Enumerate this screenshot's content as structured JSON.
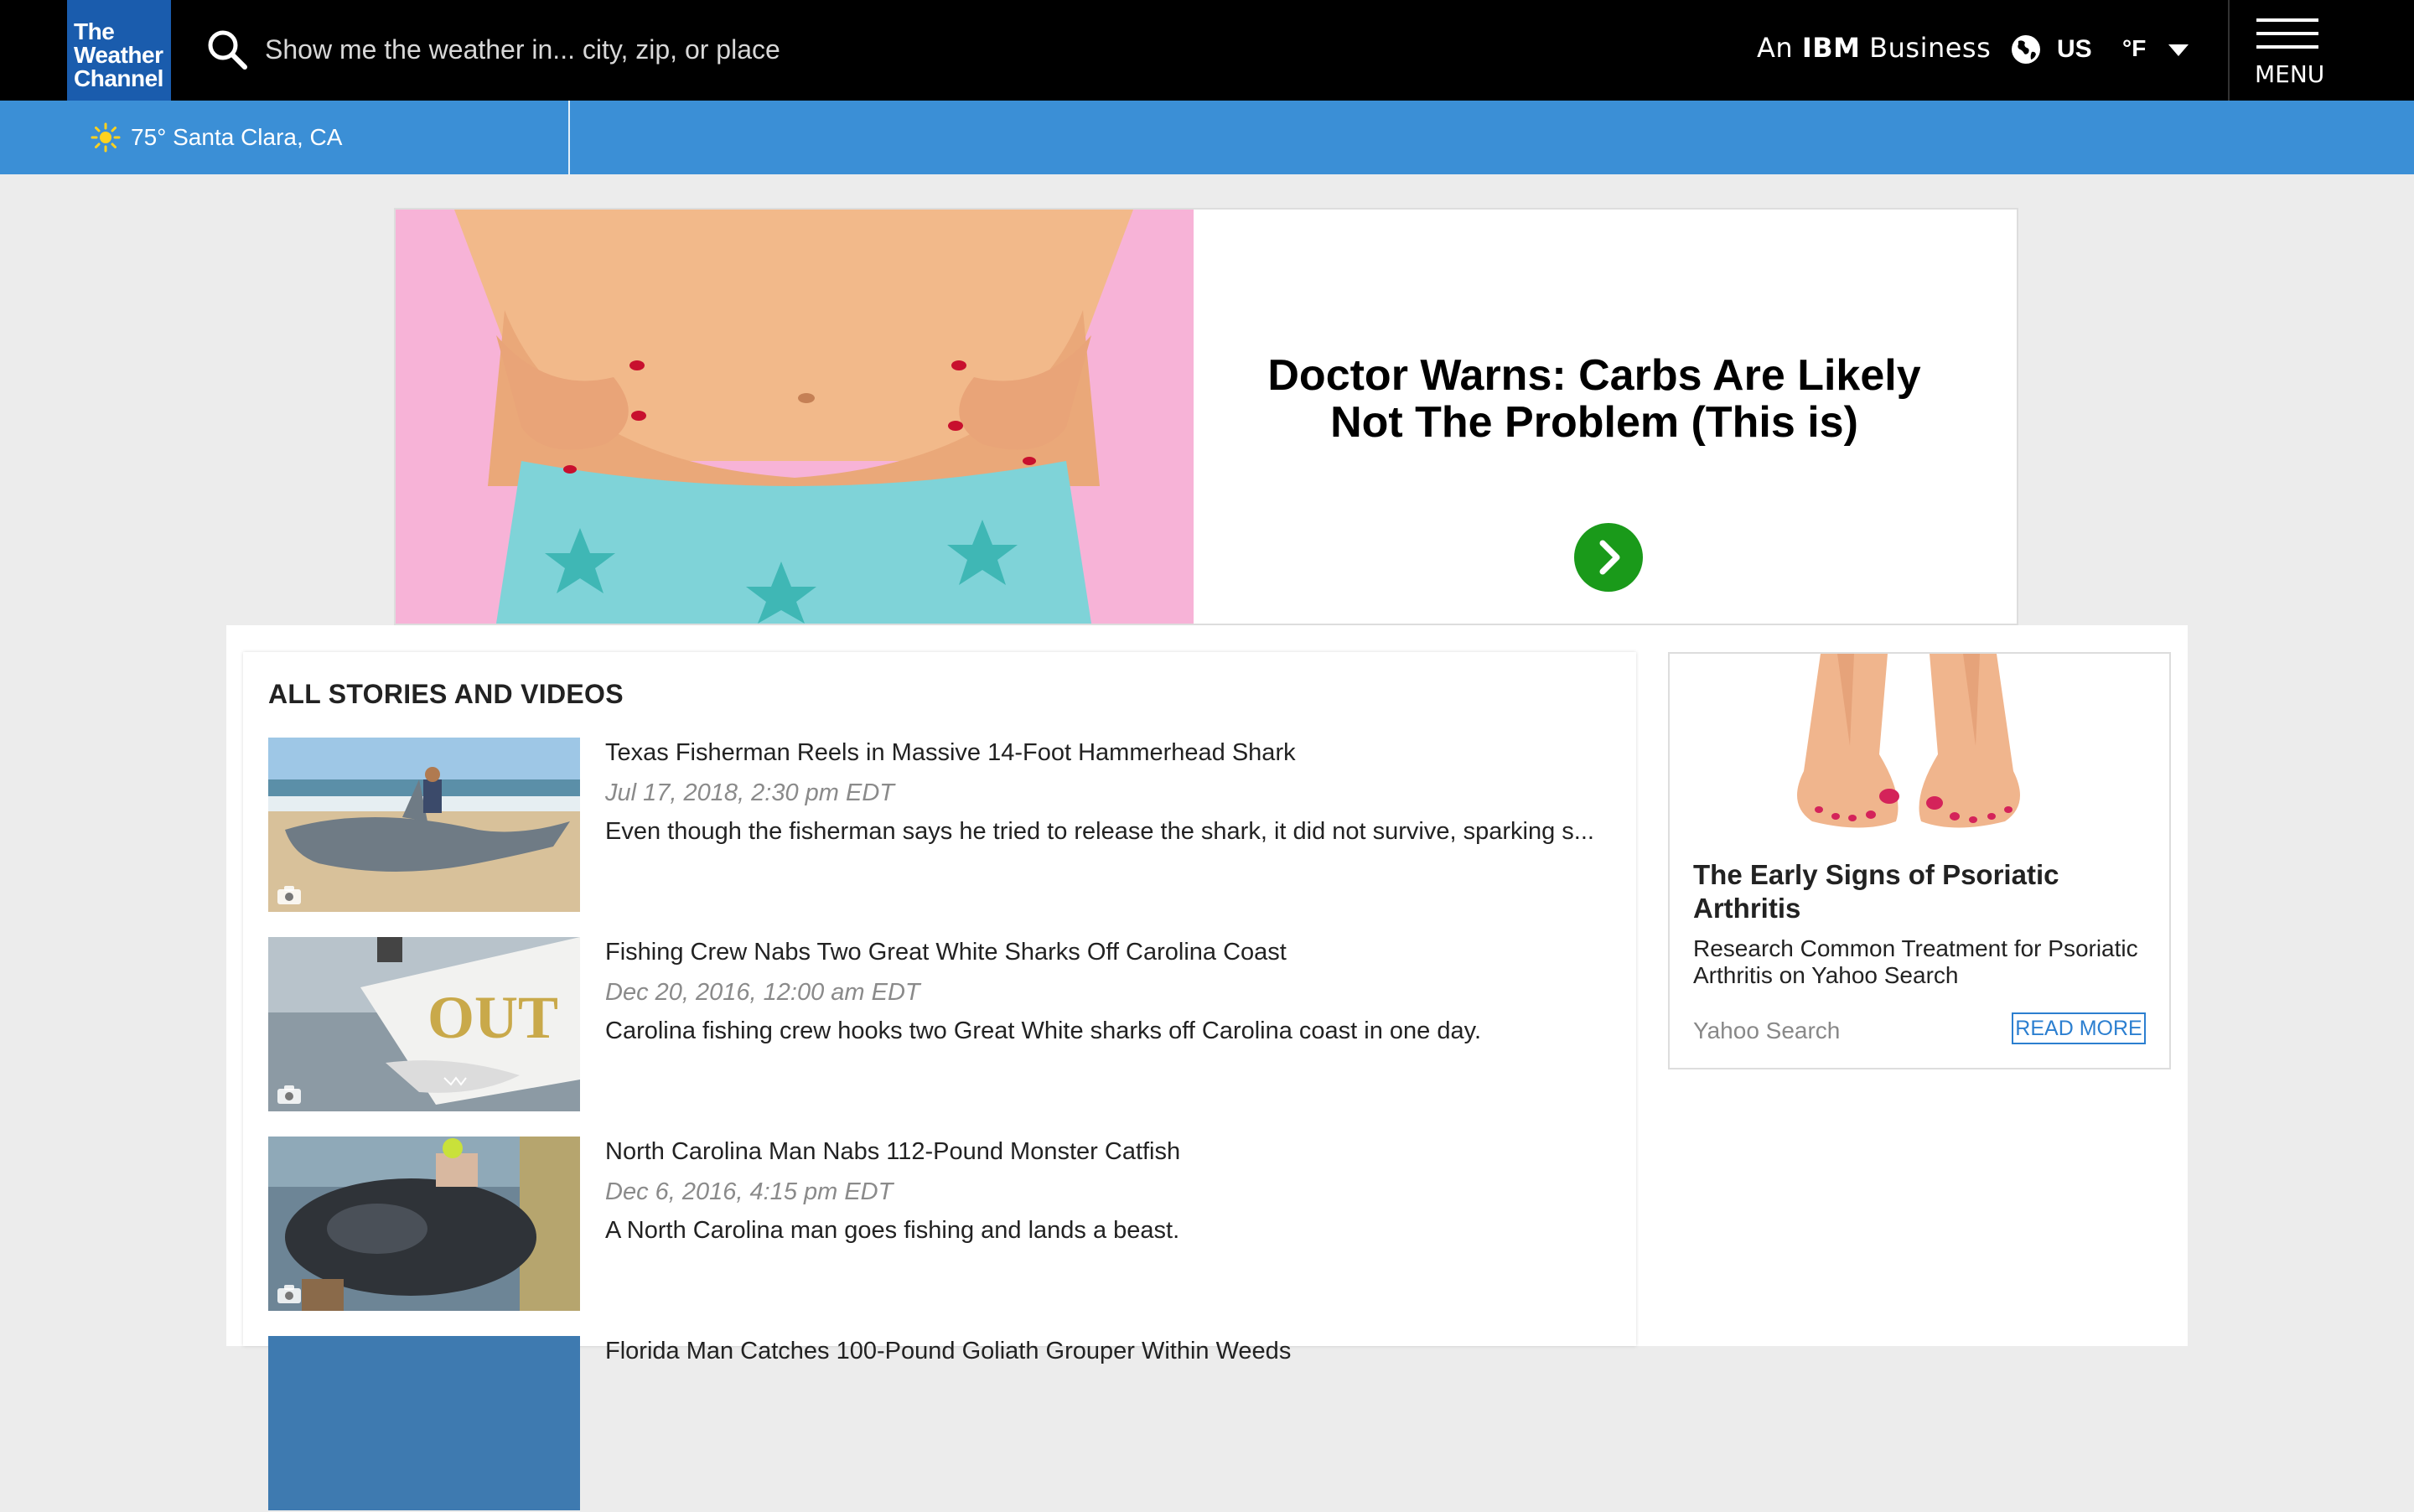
{
  "header": {
    "logo_line1": "The",
    "logo_line2": "Weather",
    "logo_line3": "Channel",
    "search_placeholder": "Show me the weather in... city, zip, or place",
    "ibm_prefix": "An ",
    "ibm_brand": "IBM",
    "ibm_suffix": " Business",
    "region": "US",
    "unit": "°F",
    "menu_label": "MENU"
  },
  "location_bar": {
    "temp_location": "75° Santa Clara, CA",
    "weather_icon": "sun-icon"
  },
  "ad_banner": {
    "headline": "Doctor Warns: Carbs Are Likely Not The Problem (This is)",
    "arrow_color": "#1a9a1a"
  },
  "stories": {
    "section_title": "ALL STORIES AND VIDEOS",
    "items": [
      {
        "title": "Texas Fisherman Reels in Massive 14-Foot Hammerhead Shark",
        "date": "Jul 17, 2018, 2:30 pm EDT",
        "description": "Even though the fisherman says he tried to release the shark, it did not survive, sparking s..."
      },
      {
        "title": "Fishing Crew Nabs Two Great White Sharks Off Carolina Coast",
        "date": "Dec 20, 2016, 12:00 am EDT",
        "description": "Carolina fishing crew hooks two Great White sharks off Carolina coast in one day."
      },
      {
        "title": "North Carolina Man Nabs 112-Pound Monster Catfish",
        "date": "Dec 6, 2016, 4:15 pm EDT",
        "description": "A North Carolina man goes fishing and lands a beast."
      },
      {
        "title": "Florida Man Catches 100-Pound Goliath Grouper Within Weeds",
        "date": "",
        "description": ""
      }
    ]
  },
  "side_ad": {
    "title": "The Early Signs of Psoriatic Arthritis",
    "description": "Research Common Treatment for Psoriatic Arthritis on Yahoo Search",
    "source": "Yahoo Search",
    "cta": "READ MORE"
  },
  "colors": {
    "top_bar": "#000000",
    "location_bar": "#3b8fd6",
    "logo_bg": "#1a5cad",
    "link_blue": "#2c7fd0"
  }
}
